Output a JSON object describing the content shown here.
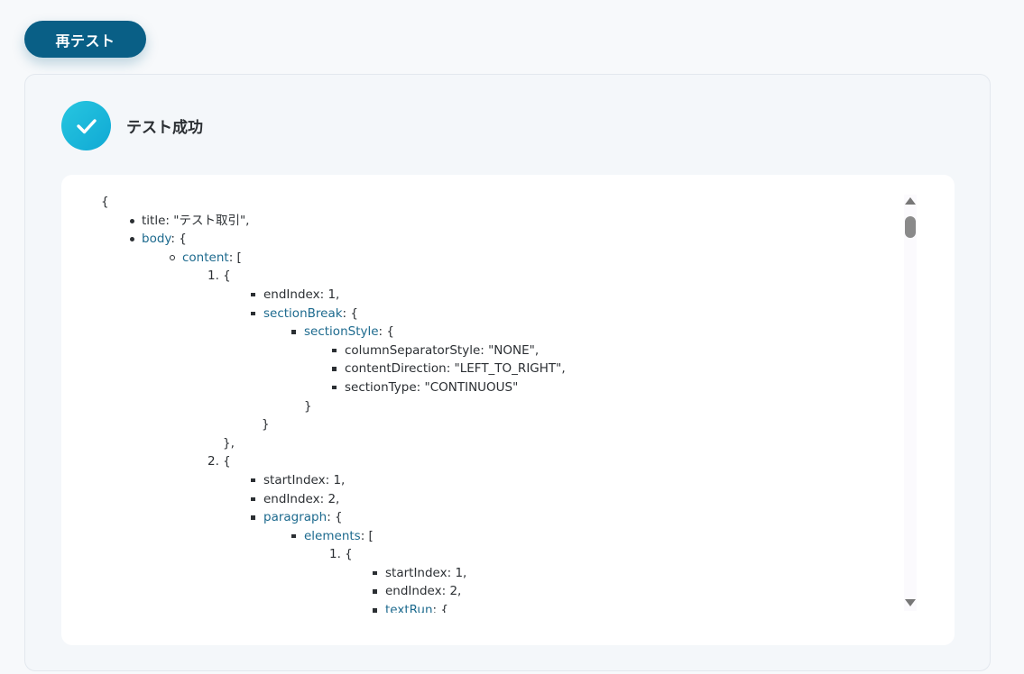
{
  "retest_button": {
    "label": "再テスト"
  },
  "status": {
    "text": "テスト成功"
  },
  "colors": {
    "button": "#095f86",
    "check": "#10a9d4",
    "key_link": "#1d6a8e",
    "card_bg": "#f4f7fa"
  },
  "json_lines": [
    {
      "indent": 112,
      "bullet": "",
      "text": "{"
    },
    {
      "indent": 157,
      "bullet": "disc",
      "key": "title",
      "rest": ": \"テスト取引\","
    },
    {
      "indent": 157,
      "bullet": "disc",
      "link": "body",
      "rest": ": {"
    },
    {
      "indent": 202,
      "bullet": "circle",
      "link": "content",
      "rest": ": ["
    },
    {
      "indent": 248,
      "bullet": "",
      "marker": "1.",
      "text": " {"
    },
    {
      "indent": 292,
      "bullet": "square",
      "key": "endIndex",
      "rest": ": 1,"
    },
    {
      "indent": 292,
      "bullet": "square",
      "link": "sectionBreak",
      "rest": ": {"
    },
    {
      "indent": 337,
      "bullet": "square",
      "link": "sectionStyle",
      "rest": ": {"
    },
    {
      "indent": 382,
      "bullet": "square",
      "key": "columnSeparatorStyle",
      "rest": ": \"NONE\","
    },
    {
      "indent": 382,
      "bullet": "square",
      "key": "contentDirection",
      "rest": ": \"LEFT_TO_RIGHT\","
    },
    {
      "indent": 382,
      "bullet": "square",
      "key": "sectionType",
      "rest": ": \"CONTINUOUS\""
    },
    {
      "indent": 337,
      "bullet": "",
      "text": "}"
    },
    {
      "indent": 290,
      "bullet": "",
      "text": "}"
    },
    {
      "indent": 247,
      "bullet": "",
      "text": "},"
    },
    {
      "indent": 248,
      "bullet": "",
      "marker": "2.",
      "text": " {"
    },
    {
      "indent": 292,
      "bullet": "square",
      "key": "startIndex",
      "rest": ": 1,"
    },
    {
      "indent": 292,
      "bullet": "square",
      "key": "endIndex",
      "rest": ": 2,"
    },
    {
      "indent": 292,
      "bullet": "square",
      "link": "paragraph",
      "rest": ": {"
    },
    {
      "indent": 337,
      "bullet": "square",
      "link": "elements",
      "rest": ": ["
    },
    {
      "indent": 383,
      "bullet": "",
      "marker": "1.",
      "text": " {"
    },
    {
      "indent": 427,
      "bullet": "square",
      "key": "startIndex",
      "rest": ": 1,"
    },
    {
      "indent": 427,
      "bullet": "square",
      "key": "endIndex",
      "rest": ": 2,"
    },
    {
      "indent": 427,
      "bullet": "square",
      "link": "textRun",
      "rest": ": {"
    }
  ]
}
